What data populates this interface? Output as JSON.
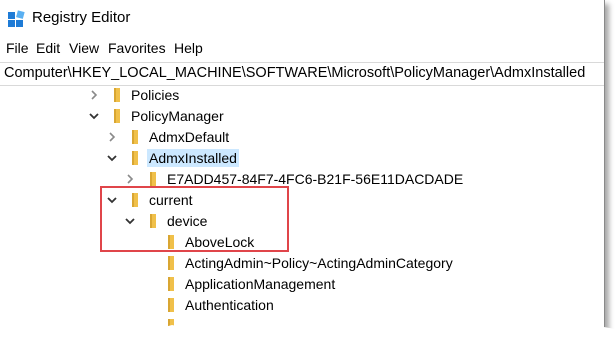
{
  "window": {
    "title": "Registry Editor",
    "app_icon": "registry-editor-icon"
  },
  "menu": {
    "items": [
      "File",
      "Edit",
      "View",
      "Favorites",
      "Help"
    ]
  },
  "address": {
    "path": "Computer\\HKEY_LOCAL_MACHINE\\SOFTWARE\\Microsoft\\PolicyManager\\AdmxInstalled"
  },
  "tree": {
    "nodes": [
      {
        "label": "Policies",
        "state": "collapsed"
      },
      {
        "label": "PolicyManager",
        "state": "expanded"
      },
      {
        "label": "AdmxDefault",
        "state": "collapsed"
      },
      {
        "label": "AdmxInstalled",
        "state": "expanded",
        "selected": true
      },
      {
        "label": "E7ADD457-84F7-4FC6-B21F-56E11DACDADE",
        "state": "collapsed"
      },
      {
        "label": "current",
        "state": "expanded"
      },
      {
        "label": "device",
        "state": "expanded"
      },
      {
        "label": "AboveLock",
        "state": "leaf"
      },
      {
        "label": "ActingAdmin~Policy~ActingAdminCategory",
        "state": "leaf"
      },
      {
        "label": "ApplicationManagement",
        "state": "leaf"
      },
      {
        "label": "Authentication",
        "state": "leaf"
      }
    ]
  },
  "colors": {
    "folder": "#f0c04a",
    "selection": "#cce8ff",
    "highlight_box": "#e0454a"
  }
}
